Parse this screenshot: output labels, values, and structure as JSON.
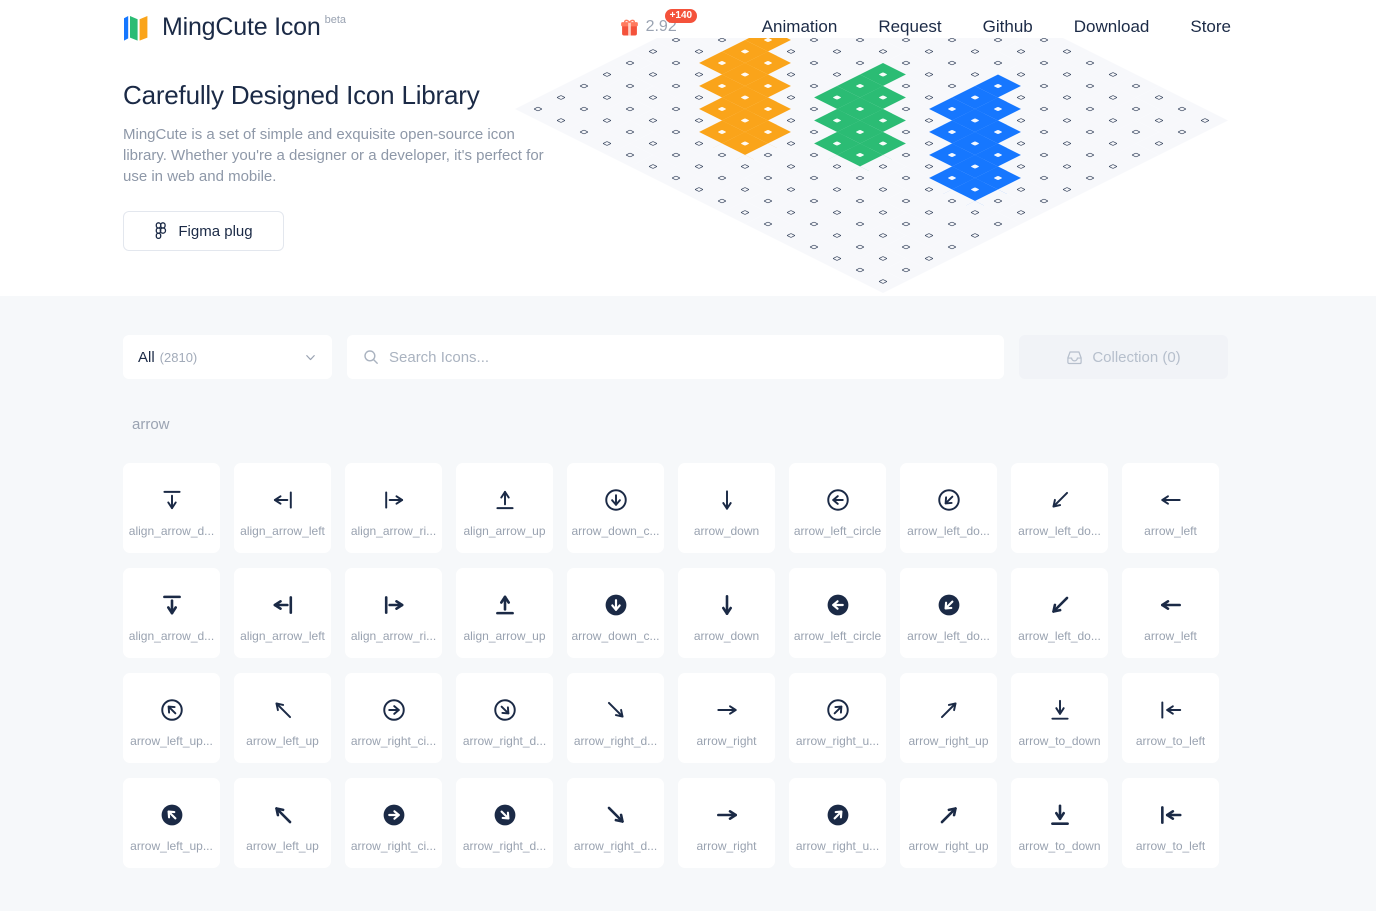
{
  "header": {
    "brand_name": "MingCute Icon",
    "brand_beta": "beta",
    "version": "2.92",
    "version_badge": "+140",
    "nav_links": [
      "Animation",
      "Request",
      "Github",
      "Download",
      "Store"
    ],
    "colors": {
      "brand_blue": "#1677FF",
      "brand_green": "#2BBC74",
      "brand_orange": "#FAA41A",
      "badge_red": "#F4523B",
      "text_dark": "#1B2A46"
    }
  },
  "hero": {
    "title": "Carefully Designed Icon Library",
    "description": "MingCute is a set of simple and exquisite open-source icon library. Whether you're a designer or a developer, it's perfect for use in web and mobile.",
    "button_label": "Figma plug",
    "button_icon": "figma-icon"
  },
  "controls": {
    "filter_label": "All",
    "filter_count": "(2810)",
    "filter_icon": "chevron-down-icon",
    "search_placeholder": "Search Icons...",
    "search_value": "",
    "search_icon": "search-icon",
    "collection_label": "Collection (0)",
    "collection_icon": "inbox-icon"
  },
  "library": {
    "section_title": "arrow",
    "icons": [
      {
        "name": "align_arrow_d...",
        "glyph": "align-arrow-down-line"
      },
      {
        "name": "align_arrow_left",
        "glyph": "align-arrow-left-line"
      },
      {
        "name": "align_arrow_ri...",
        "glyph": "align-arrow-right-line"
      },
      {
        "name": "align_arrow_up",
        "glyph": "align-arrow-up-line"
      },
      {
        "name": "arrow_down_c...",
        "glyph": "arrow-down-circle-line"
      },
      {
        "name": "arrow_down",
        "glyph": "arrow-down-line"
      },
      {
        "name": "arrow_left_circle",
        "glyph": "arrow-left-circle-line"
      },
      {
        "name": "arrow_left_do...",
        "glyph": "arrow-left-down-circle-line"
      },
      {
        "name": "arrow_left_do...",
        "glyph": "arrow-left-down-line"
      },
      {
        "name": "arrow_left",
        "glyph": "arrow-left-line"
      },
      {
        "name": "align_arrow_d...",
        "glyph": "align-arrow-down-fill"
      },
      {
        "name": "align_arrow_left",
        "glyph": "align-arrow-left-fill"
      },
      {
        "name": "align_arrow_ri...",
        "glyph": "align-arrow-right-fill"
      },
      {
        "name": "align_arrow_up",
        "glyph": "align-arrow-up-fill"
      },
      {
        "name": "arrow_down_c...",
        "glyph": "arrow-down-circle-fill"
      },
      {
        "name": "arrow_down",
        "glyph": "arrow-down-fill"
      },
      {
        "name": "arrow_left_circle",
        "glyph": "arrow-left-circle-fill"
      },
      {
        "name": "arrow_left_do...",
        "glyph": "arrow-left-down-circle-fill"
      },
      {
        "name": "arrow_left_do...",
        "glyph": "arrow-left-down-fill"
      },
      {
        "name": "arrow_left",
        "glyph": "arrow-left-fill"
      },
      {
        "name": "arrow_left_up...",
        "glyph": "arrow-left-up-circle-line"
      },
      {
        "name": "arrow_left_up",
        "glyph": "arrow-left-up-line"
      },
      {
        "name": "arrow_right_ci...",
        "glyph": "arrow-right-circle-line"
      },
      {
        "name": "arrow_right_d...",
        "glyph": "arrow-right-down-circle-line"
      },
      {
        "name": "arrow_right_d...",
        "glyph": "arrow-right-down-line"
      },
      {
        "name": "arrow_right",
        "glyph": "arrow-right-line"
      },
      {
        "name": "arrow_right_u...",
        "glyph": "arrow-right-up-circle-line"
      },
      {
        "name": "arrow_right_up",
        "glyph": "arrow-right-up-line"
      },
      {
        "name": "arrow_to_down",
        "glyph": "arrow-to-down-line"
      },
      {
        "name": "arrow_to_left",
        "glyph": "arrow-to-left-line"
      },
      {
        "name": "arrow_left_up...",
        "glyph": "arrow-left-up-circle-fill"
      },
      {
        "name": "arrow_left_up",
        "glyph": "arrow-left-up-fill"
      },
      {
        "name": "arrow_right_ci...",
        "glyph": "arrow-right-circle-fill"
      },
      {
        "name": "arrow_right_d...",
        "glyph": "arrow-right-down-circle-fill"
      },
      {
        "name": "arrow_right_d...",
        "glyph": "arrow-right-down-fill"
      },
      {
        "name": "arrow_right",
        "glyph": "arrow-right-fill"
      },
      {
        "name": "arrow_right_u...",
        "glyph": "arrow-right-up-circle-fill"
      },
      {
        "name": "arrow_right_up",
        "glyph": "arrow-right-up-fill"
      },
      {
        "name": "arrow_to_down",
        "glyph": "arrow-to-down-fill"
      },
      {
        "name": "arrow_to_left",
        "glyph": "arrow-to-left-fill"
      }
    ]
  }
}
